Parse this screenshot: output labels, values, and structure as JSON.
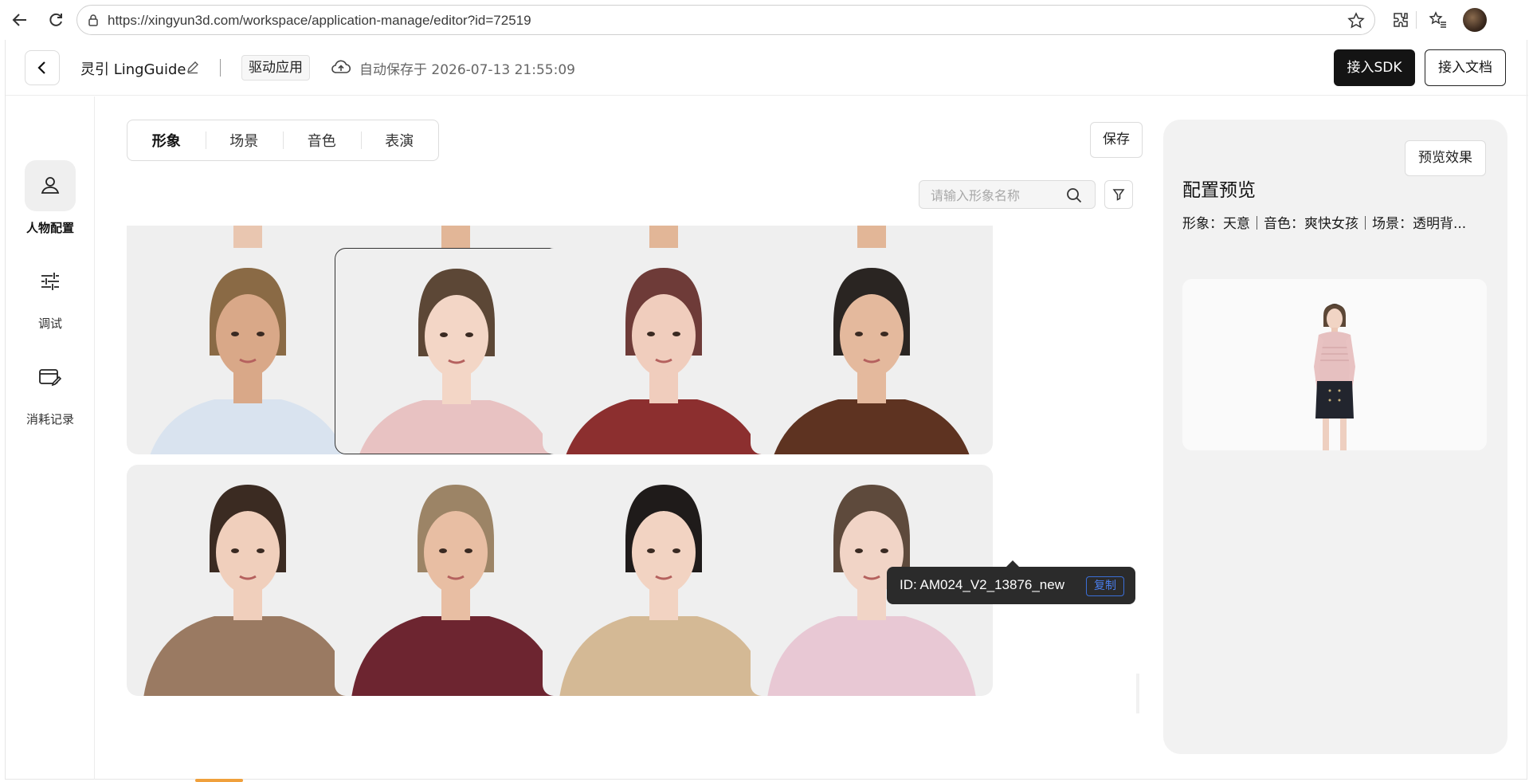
{
  "browser": {
    "url": "https://xingyun3d.com/workspace/application-manage/editor?id=72519"
  },
  "header": {
    "app_name": "灵引 LingGuide",
    "app_type": "驱动应用",
    "autosave_text": "自动保存于 2026-07-13 21:55:09",
    "sdk_button": "接入SDK",
    "docs_button": "接入文档"
  },
  "sidebar": {
    "items": [
      {
        "label": "人物配置",
        "icon": "person-icon",
        "active": true
      },
      {
        "label": "调试",
        "icon": "sliders-icon",
        "active": false
      },
      {
        "label": "消耗记录",
        "icon": "card-edit-icon",
        "active": false
      }
    ]
  },
  "tabs": [
    {
      "label": "形象",
      "active": true
    },
    {
      "label": "场景",
      "active": false
    },
    {
      "label": "音色",
      "active": false
    },
    {
      "label": "表演",
      "active": false
    }
  ],
  "toolbar": {
    "save_label": "保存",
    "search_placeholder": "请输入形象名称"
  },
  "avatar_grid": {
    "rows": 3,
    "columns": 4,
    "selected_index": 5,
    "cards": [
      {
        "shirt": "#d26fa9",
        "skin": "#e9c6b0",
        "hair": "#3a2b22"
      },
      {
        "shirt": "#4d6288",
        "skin": "#e2b697",
        "hair": "#3a2b22"
      },
      {
        "shirt": "#1d2742",
        "skin": "#e2b697",
        "hair": "#3a2b22"
      },
      {
        "shirt": "#4a4a48",
        "skin": "#e2b697",
        "hair": "#3a2b22"
      },
      {
        "shirt": "#d9e3ef",
        "skin": "#d9a888",
        "hair": "#8a6a45"
      },
      {
        "shirt": "#e8c2c2",
        "skin": "#f3d6c6",
        "hair": "#5c4736"
      },
      {
        "shirt": "#8c2f2f",
        "skin": "#f0cdbd",
        "hair": "#6e3b38"
      },
      {
        "shirt": "#5e3321",
        "skin": "#e4b99d",
        "hair": "#2a2522"
      },
      {
        "shirt": "#9a7a62",
        "skin": "#f0cfbc",
        "hair": "#3b2b22"
      },
      {
        "shirt": "#6d2530",
        "skin": "#e8bea3",
        "hair": "#9c8466"
      },
      {
        "shirt": "#d4b995",
        "skin": "#f2d3c2",
        "hair": "#1f1b1a"
      },
      {
        "shirt": "#e8c8d4",
        "skin": "#f1d4c6",
        "hair": "#5e4a3c"
      }
    ]
  },
  "tooltip": {
    "text": "ID: AM024_V2_13876_new",
    "copy_label": "复制"
  },
  "preview": {
    "button_label": "预览效果",
    "title": "配置预览",
    "summary": "形象：天意｜音色：爽快女孩｜场景：透明背..."
  }
}
